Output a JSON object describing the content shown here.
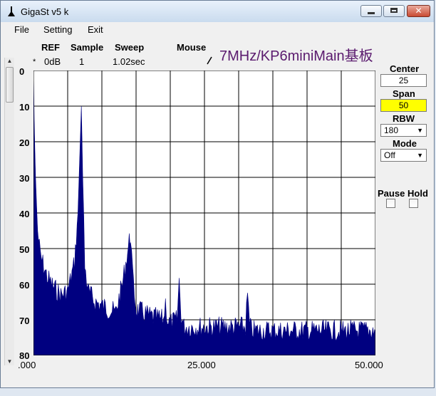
{
  "window": {
    "title": "GigaSt v5 k"
  },
  "menu": [
    "File",
    "Setting",
    "Exit"
  ],
  "header": {
    "ref_label": "REF",
    "ref_value": "0dB",
    "sample_label": "Sample",
    "sample_value": "1",
    "sweep_label": "Sweep",
    "sweep_value": "1.02sec",
    "mouse_label": "Mouse",
    "marker": "*",
    "plot_title": "7MHz/KP6miniMain基板"
  },
  "controls": {
    "center_label": "Center",
    "center_value": "25",
    "span_label": "Span",
    "span_value": "50",
    "rbw_label": "RBW",
    "rbw_value": "180",
    "mode_label": "Mode",
    "mode_value": "Off",
    "pause_label": "Pause",
    "hold_label": "Hold"
  },
  "colors": {
    "trace": "#000080",
    "title": "#5a1a6e",
    "span_bg": "#ffff00"
  },
  "chart_data": {
    "type": "area",
    "title": "7MHz/KP6miniMain基板",
    "xlim": [
      0,
      50
    ],
    "ylim": [
      0,
      80
    ],
    "y_inverted": true,
    "x_tick_labels": [
      ".000",
      "25.000",
      "50.000"
    ],
    "y_tick_labels": [
      "0",
      "10",
      "20",
      "30",
      "40",
      "50",
      "60",
      "70",
      "80"
    ],
    "grid": true,
    "series": [
      {
        "x": [
          0,
          0.1,
          0.3,
          0.6,
          1.0,
          1.5,
          2.0,
          3.0,
          4.0,
          5.0,
          6.0,
          6.5,
          7.0,
          7.2,
          7.5,
          8.0,
          9.0,
          10.0,
          11.0,
          12.0,
          13.0,
          14.0,
          14.2,
          14.5,
          15.0,
          17.0,
          19.0,
          19.3,
          19.6,
          20.0,
          21.0,
          21.3,
          21.6,
          22.0,
          25.0,
          28.0,
          31.0,
          31.3,
          31.6,
          32.0,
          35.0,
          40.0,
          45.0,
          50.0
        ],
        "y": [
          0,
          14,
          30,
          45,
          52,
          55,
          58,
          61,
          63,
          62,
          54,
          40,
          10,
          30,
          55,
          62,
          65,
          66,
          67,
          68,
          60,
          48,
          46,
          58,
          67,
          69,
          70,
          65,
          70,
          71,
          70,
          59,
          69,
          72,
          72,
          72,
          72,
          63,
          72,
          73,
          73,
          73,
          73,
          73
        ]
      }
    ]
  }
}
